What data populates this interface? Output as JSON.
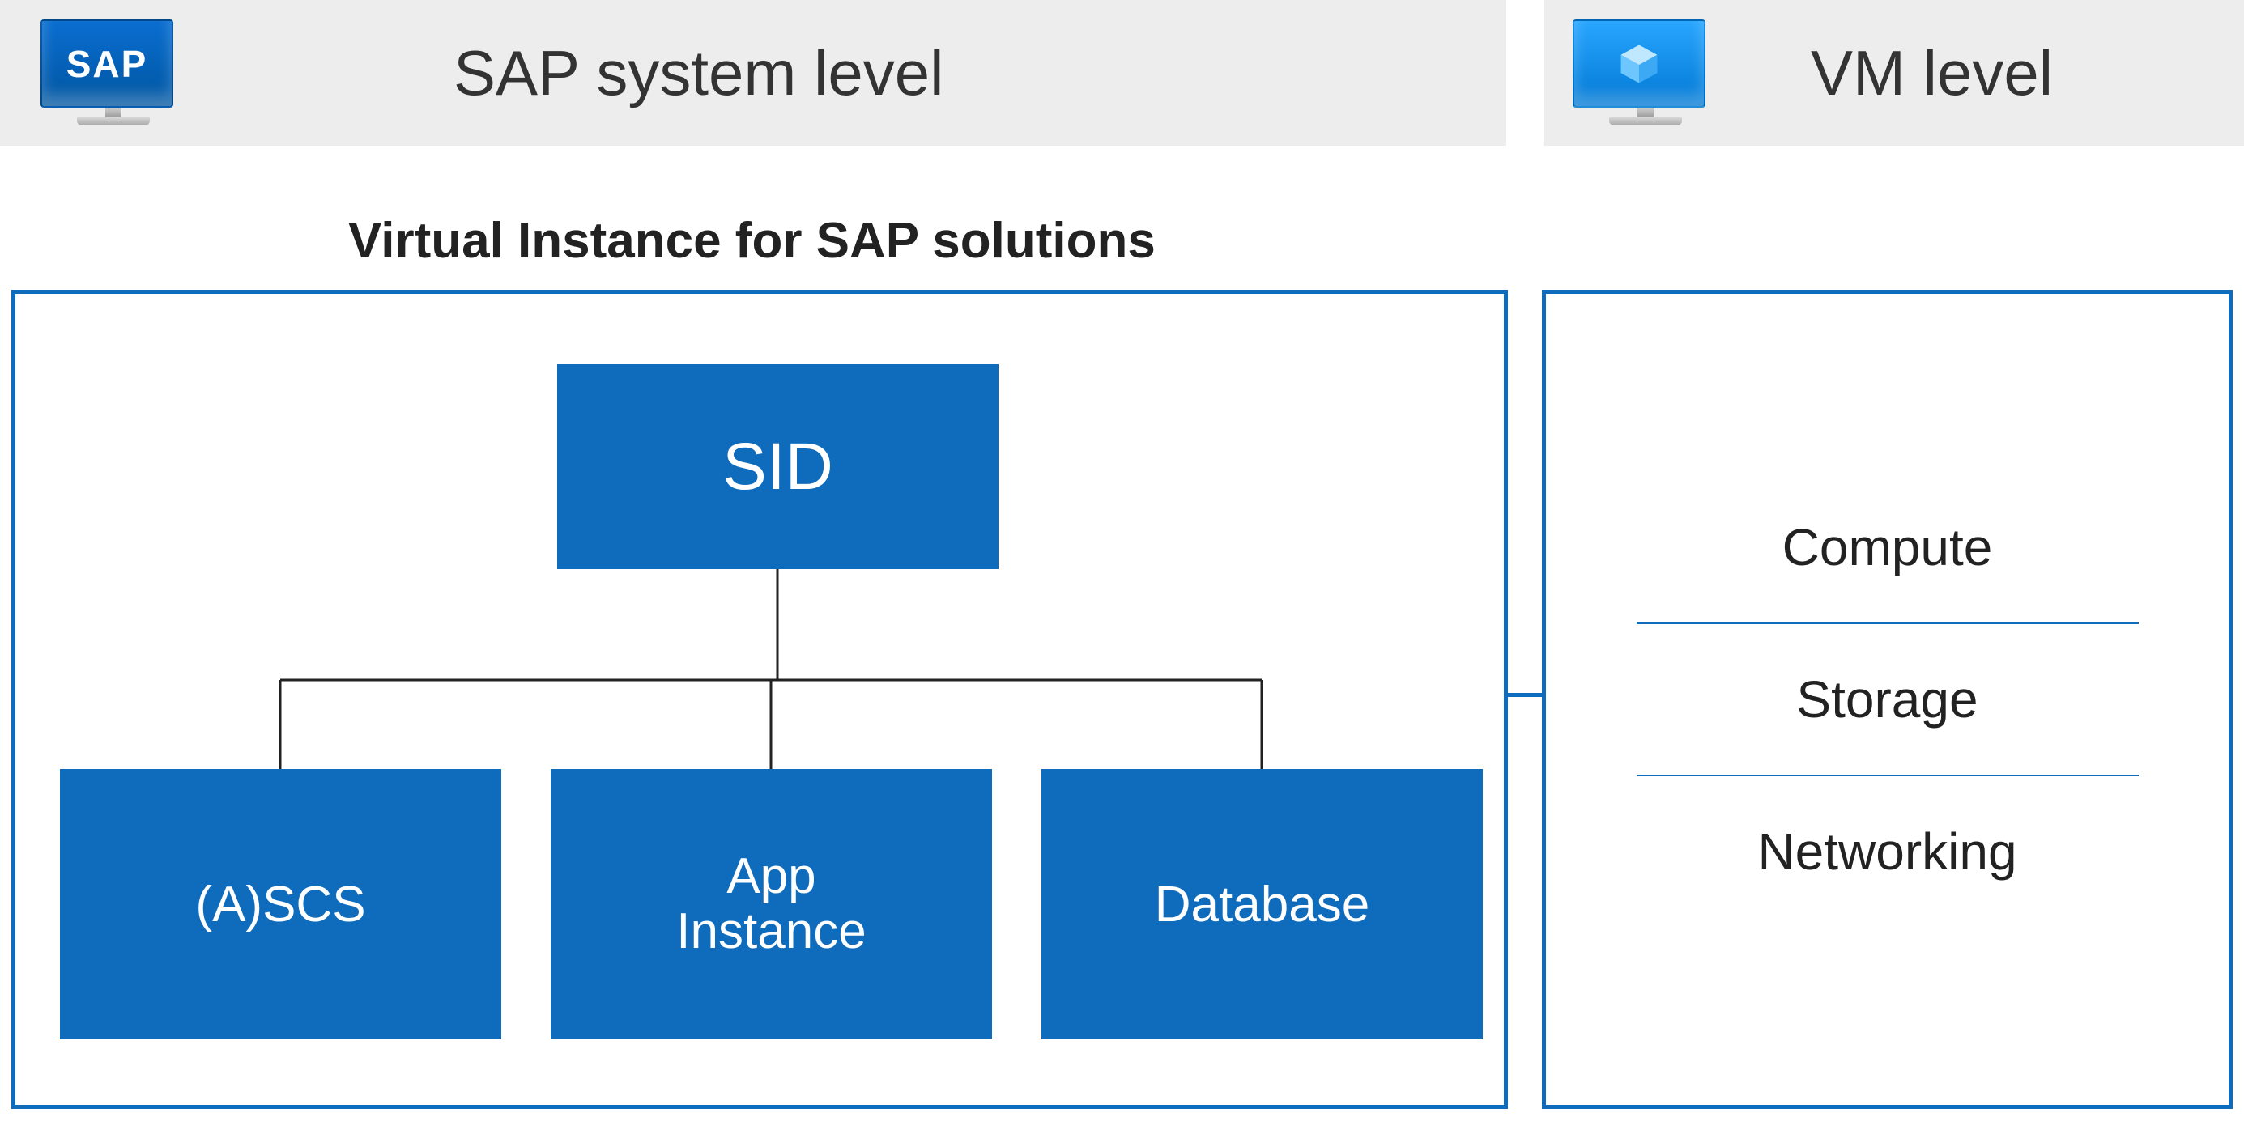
{
  "header": {
    "left_title": "SAP system level",
    "right_title": "VM level",
    "sap_logo_text": "SAP"
  },
  "vis": {
    "title": "Virtual Instance for SAP solutions",
    "root": "SID",
    "children": {
      "ascs": "(A)SCS",
      "app_line1": "App",
      "app_line2": "Instance",
      "database": "Database"
    }
  },
  "vm": {
    "items": [
      "Compute",
      "Storage",
      "Networking"
    ]
  },
  "colors": {
    "accent": "#0f6cbd",
    "header_bg": "#ededed"
  }
}
